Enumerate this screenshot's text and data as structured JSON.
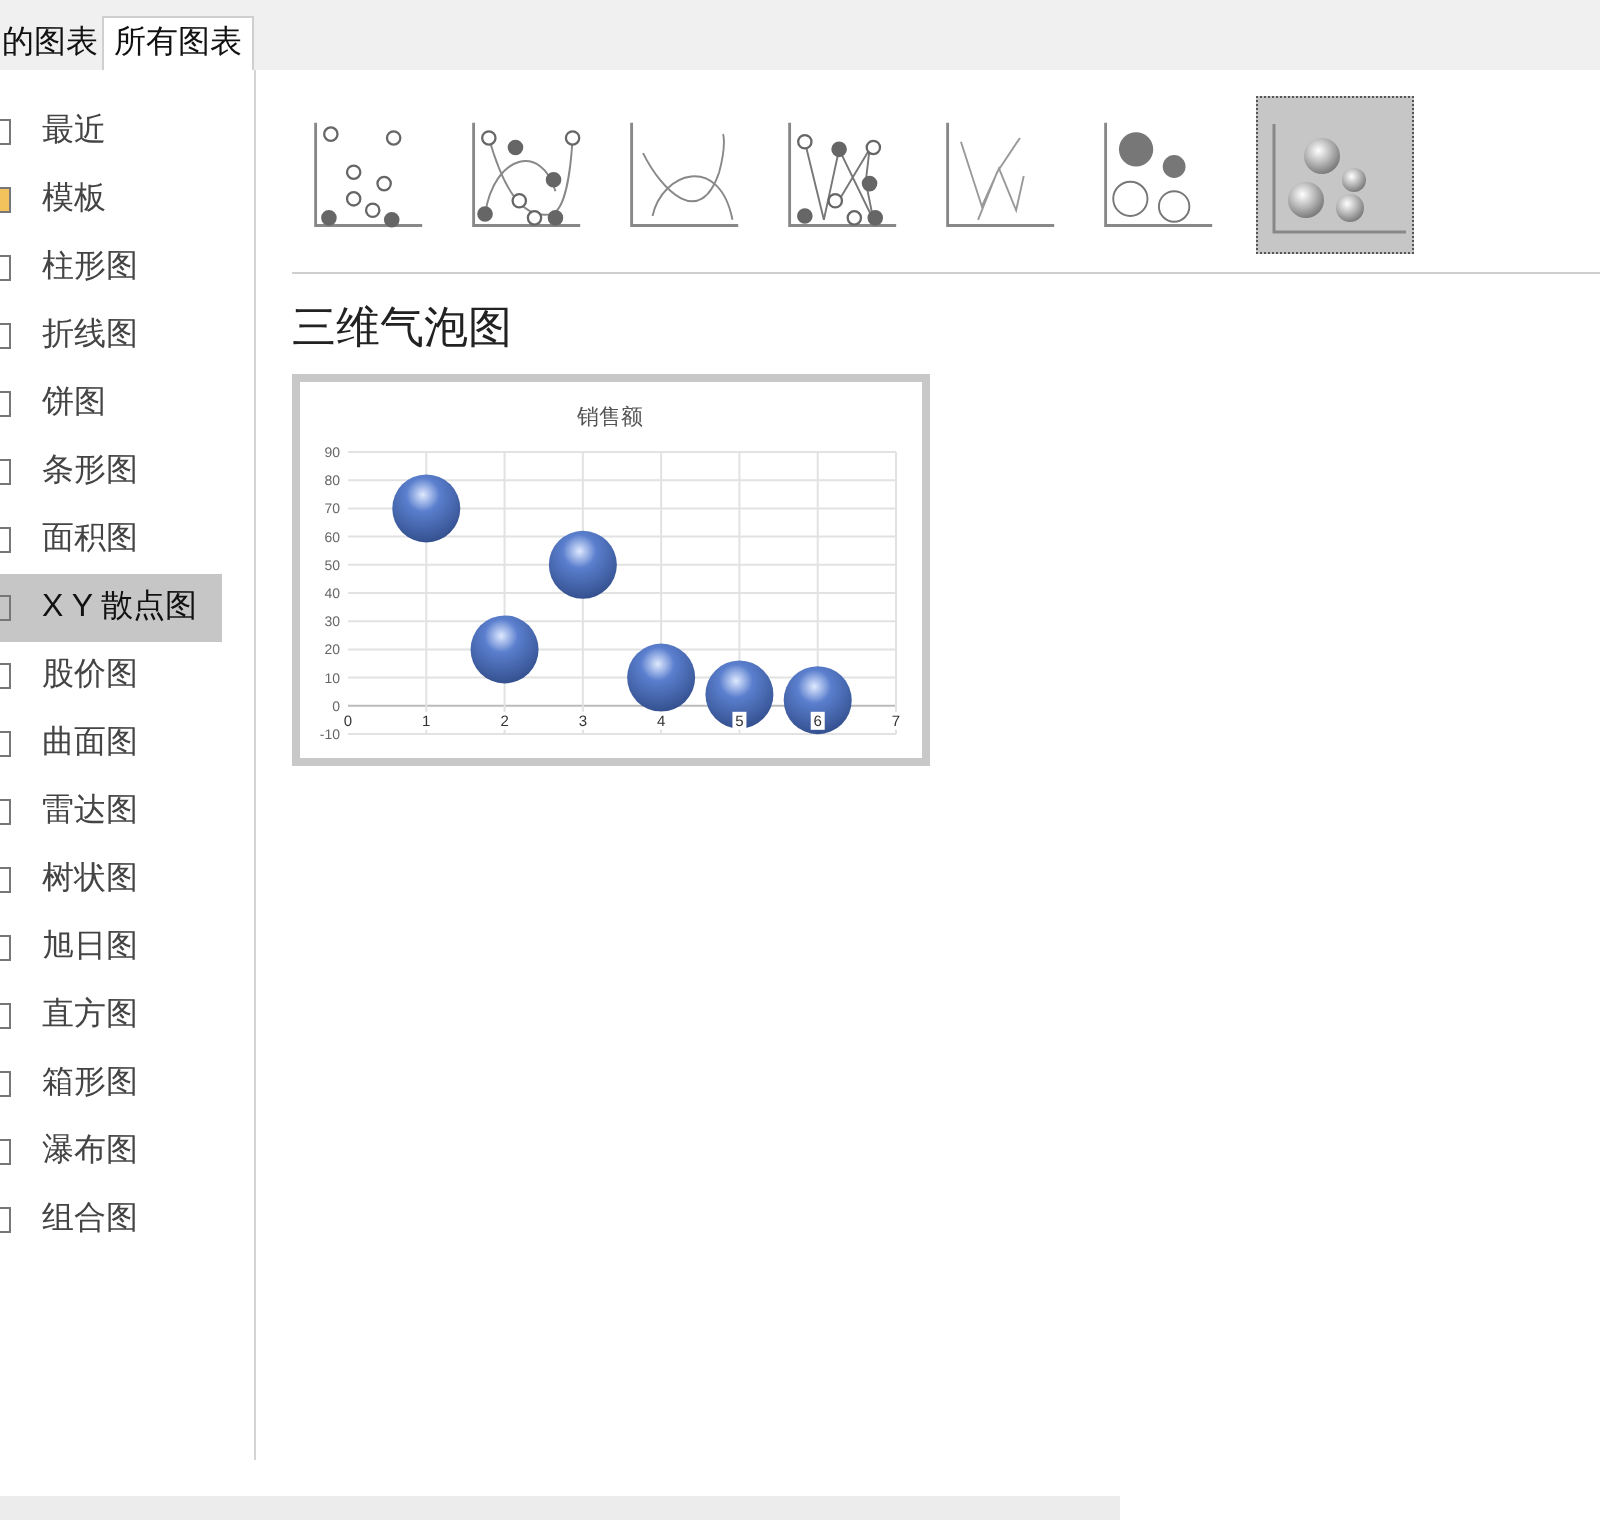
{
  "tabs": [
    {
      "label": "的图表",
      "selected": false
    },
    {
      "label": "所有图表",
      "selected": true
    }
  ],
  "sidebar": {
    "items": [
      {
        "label": "最近",
        "selected": false
      },
      {
        "label": "模板",
        "selected": false
      },
      {
        "label": "柱形图",
        "selected": false
      },
      {
        "label": "折线图",
        "selected": false
      },
      {
        "label": "饼图",
        "selected": false
      },
      {
        "label": "条形图",
        "selected": false
      },
      {
        "label": "面积图",
        "selected": false
      },
      {
        "label": "X Y 散点图",
        "selected": true
      },
      {
        "label": "股价图",
        "selected": false
      },
      {
        "label": "曲面图",
        "selected": false
      },
      {
        "label": "雷达图",
        "selected": false
      },
      {
        "label": "树状图",
        "selected": false
      },
      {
        "label": "旭日图",
        "selected": false
      },
      {
        "label": "直方图",
        "selected": false
      },
      {
        "label": "箱形图",
        "selected": false
      },
      {
        "label": "瀑布图",
        "selected": false
      },
      {
        "label": "组合图",
        "selected": false
      }
    ]
  },
  "subtypes": [
    {
      "kind": "markers",
      "selected": false
    },
    {
      "kind": "smooth-markers",
      "selected": false
    },
    {
      "kind": "smooth",
      "selected": false
    },
    {
      "kind": "straight-markers",
      "selected": false
    },
    {
      "kind": "straight",
      "selected": false
    },
    {
      "kind": "bubble",
      "selected": false
    },
    {
      "kind": "bubble3d",
      "selected": true
    }
  ],
  "subtype_title": "三维气泡图",
  "preview": {
    "chart_data": {
      "type": "scatter",
      "title": "销售额",
      "x": [
        1,
        2,
        3,
        4,
        5,
        6
      ],
      "grid": true,
      "series": [
        {
          "color": "#5b7fce",
          "values": [
            70,
            20,
            50,
            10,
            4,
            2
          ]
        }
      ],
      "xlim": [
        0,
        7
      ],
      "ylim": [
        -10,
        90
      ],
      "xticks": [
        0,
        1,
        2,
        3,
        4,
        5,
        6,
        7
      ],
      "yticks": [
        -10,
        0,
        10,
        20,
        30,
        40,
        50,
        60,
        70,
        80,
        90
      ]
    }
  }
}
